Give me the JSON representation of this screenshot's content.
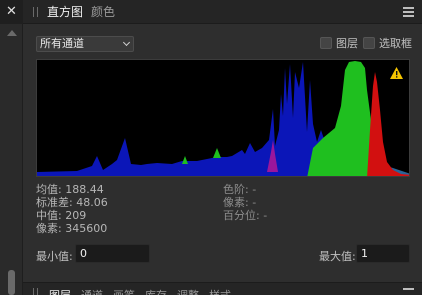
{
  "header": {
    "tabs": [
      {
        "label": "直方图",
        "active": true
      },
      {
        "label": "颜色",
        "active": false
      }
    ],
    "icons": [
      "close-icon",
      "grip-icon",
      "menu-icon"
    ]
  },
  "controls": {
    "channel_select": {
      "value": "所有通道"
    },
    "layer_checkbox": {
      "label": "图层",
      "checked": false
    },
    "selection_checkbox": {
      "label": "选取框",
      "checked": false
    }
  },
  "histogram": {
    "warning_icon": "warning-icon",
    "colors": {
      "blue": "#0b16b8",
      "green": "#1fbf1f",
      "red": "#d21010",
      "magenta": "#9a169c",
      "cyan": "#2d6fa7"
    }
  },
  "stats_left": [
    "均值: 188.44",
    "标准差: 48.06",
    "中值: 209",
    "像素: 345600"
  ],
  "stats_right": [
    "色阶: -",
    "像素: -",
    "百分位: -"
  ],
  "range": {
    "min_label": "最小值:",
    "min_value": "0",
    "max_label": "最大值:",
    "max_value": "1"
  },
  "bottom_tabs": [
    "图层",
    "通道",
    "画笔",
    "库存",
    "调整",
    "样式"
  ]
}
